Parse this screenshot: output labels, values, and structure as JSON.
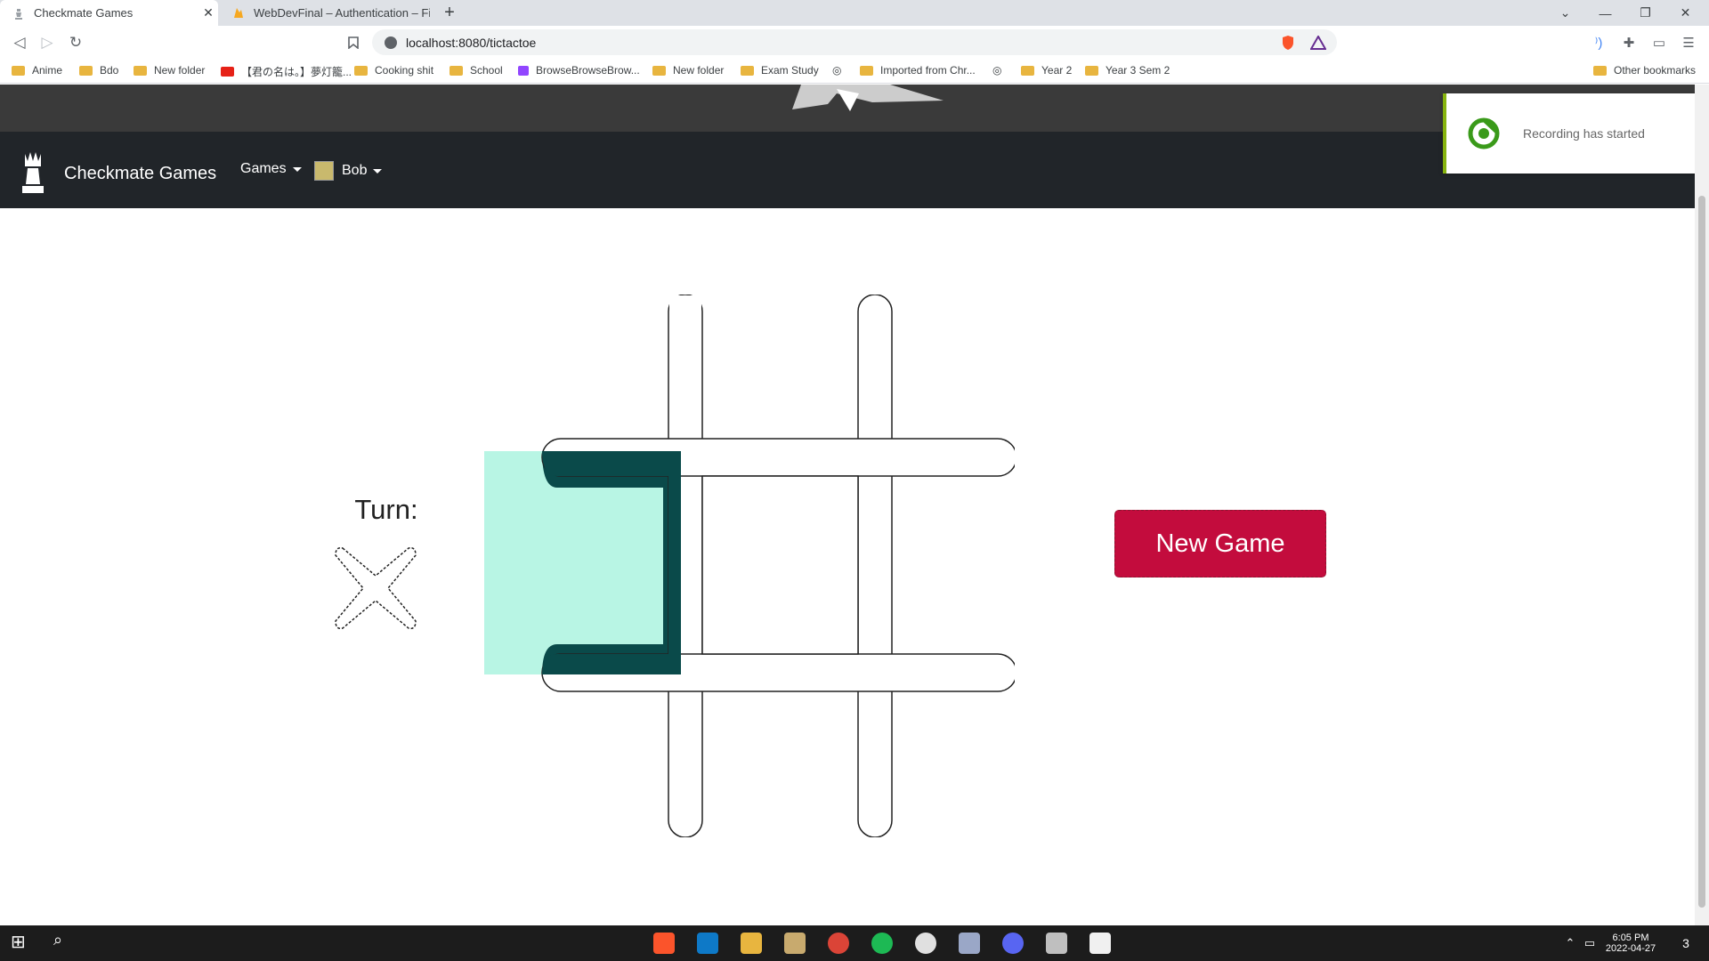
{
  "browser": {
    "tabs": [
      {
        "title": "Checkmate Games",
        "active": true
      },
      {
        "title": "WebDevFinal – Authentication – Firebase",
        "active": false
      }
    ],
    "new_tab": "+",
    "close_tab": "✕",
    "url": "localhost:8080/tictactoe",
    "bookmarks": [
      "Anime",
      "Bdo",
      "New folder",
      "【君の名は。】夢灯籠...",
      "Cooking shit",
      "School",
      "BrowseBrowseBrow...",
      "New folder",
      "Exam Study",
      "Imported from Chr...",
      "Year 2",
      "Year 3 Sem 2"
    ],
    "other_bookmarks": "Other bookmarks"
  },
  "site": {
    "brand": "Checkmate Games",
    "nav_games": "Games",
    "nav_user": "Bob"
  },
  "toast": {
    "message": "Recording has started"
  },
  "game": {
    "turn_label": "Turn:",
    "current_turn": "X",
    "new_game_label": "New Game",
    "highlight_color": "#b8f5e4",
    "board_color": "#0a4a4a"
  },
  "taskbar": {
    "time": "6:05 PM",
    "date": "2022-04-27",
    "notifications": "3"
  }
}
